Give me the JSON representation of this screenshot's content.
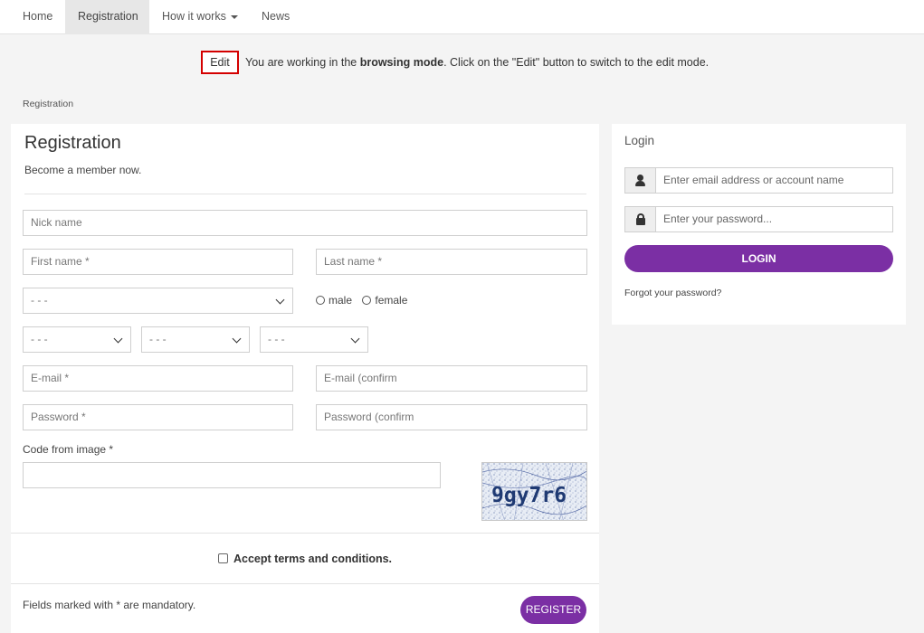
{
  "nav": {
    "items": [
      {
        "label": "Home"
      },
      {
        "label": "Registration",
        "active": true
      },
      {
        "label": "How it works",
        "dropdown": true
      },
      {
        "label": "News"
      }
    ]
  },
  "edit_bar": {
    "button_label": "Edit",
    "message_prefix": "You are working in the ",
    "message_bold": "browsing mode",
    "message_suffix": ". Click on the \"Edit\" button to switch to the edit mode."
  },
  "breadcrumb": "Registration",
  "registration": {
    "title": "Registration",
    "subtitle": "Become a member now.",
    "fields": {
      "nickname_placeholder": "Nick name",
      "firstname_placeholder": "First name *",
      "lastname_placeholder": "Last name *",
      "gender_select": "- - -",
      "gender_options": [
        "male",
        "female"
      ],
      "birth_day_select": "- - -",
      "birth_month_select": "- - -",
      "birth_year_select": "- - -",
      "email_placeholder": "E-mail *",
      "email_confirm_placeholder": "E-mail (confirm",
      "password_placeholder": "Password *",
      "password_confirm_placeholder": "Password (confirm"
    },
    "code_label": "Code from image *",
    "captcha_text": "9gy7r6",
    "accept_label": "Accept terms and conditions.",
    "mandatory_note": "Fields marked with * are mandatory.",
    "register_label": "REGISTER"
  },
  "login": {
    "title": "Login",
    "user_placeholder": "Enter email address or account name",
    "password_placeholder": "Enter your password...",
    "login_label": "LOGIN",
    "forgot_label": "Forgot your password?"
  },
  "colors": {
    "accent": "#7b2fa4",
    "edit_border": "#d40000",
    "background": "#f4f4f4"
  }
}
